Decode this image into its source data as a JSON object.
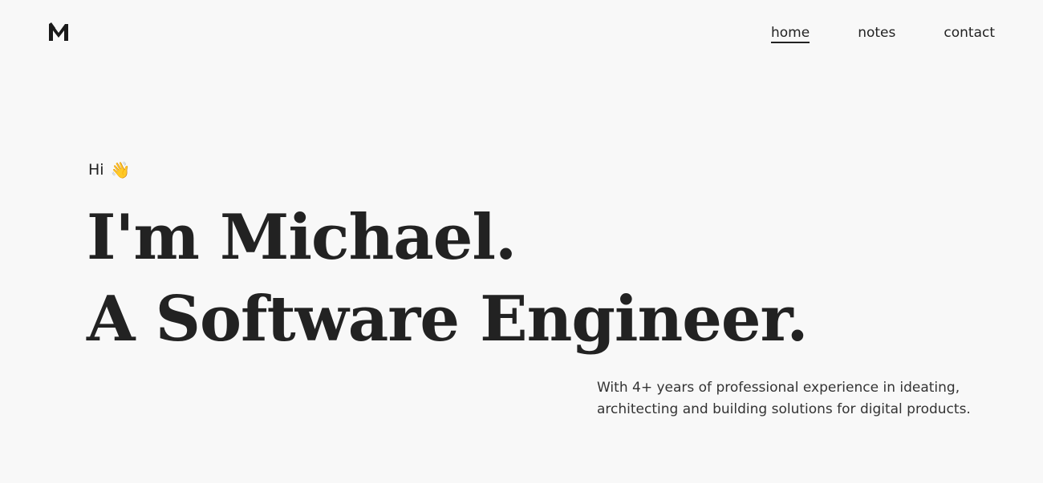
{
  "logo": {
    "icon": "m-monogram-icon"
  },
  "nav": {
    "items": [
      {
        "label": "home",
        "active": true
      },
      {
        "label": "notes",
        "active": false
      },
      {
        "label": "contact",
        "active": false
      }
    ]
  },
  "hero": {
    "greeting": "Hi",
    "greeting_emoji": "👋",
    "headline_line1": "I'm Michael.",
    "headline_line2": "A Software Engineer.",
    "intro_line1": "With 4+ years of professional experience in ideating,",
    "intro_line2": "architecting and building solutions for digital products."
  },
  "colors": {
    "background": "#f8f8f8",
    "text": "#222222"
  }
}
